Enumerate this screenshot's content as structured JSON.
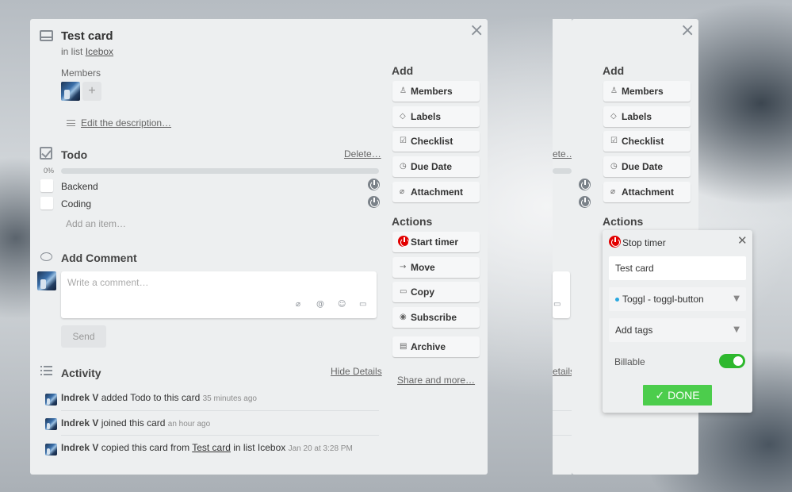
{
  "card": {
    "title": "Test card",
    "in_list_prefix": "in list",
    "list_name": "Icebox",
    "members_label": "Members",
    "add_member": "+",
    "description_link": "Edit the description…"
  },
  "checklist": {
    "title": "Todo",
    "delete": "Delete…",
    "progress_text": "0%",
    "progress_value": 0,
    "items": [
      {
        "label": "Backend"
      },
      {
        "label": "Coding"
      }
    ],
    "add_item": "Add an item…"
  },
  "comment": {
    "title": "Add Comment",
    "placeholder": "Write a comment…",
    "send": "Send",
    "icons": [
      "attachment-icon",
      "mention-icon",
      "emoji-icon",
      "card-link-icon"
    ]
  },
  "activity": {
    "title": "Activity",
    "hide_details": "Hide Details",
    "entries": [
      {
        "user": "Indrek V",
        "text": "added Todo to this card",
        "time": "35 minutes ago"
      },
      {
        "user": "Indrek V",
        "text": "joined this card",
        "time": "an hour ago"
      },
      {
        "user": "Indrek V",
        "text_before": "copied this card from",
        "link": "Test card",
        "text_after": "in list Icebox",
        "time": "Jan 20 at 3:28 PM"
      }
    ]
  },
  "sidebar": {
    "add_heading": "Add",
    "add_buttons": [
      {
        "label": "Members",
        "icon": "person-icon"
      },
      {
        "label": "Labels",
        "icon": "tag-icon"
      },
      {
        "label": "Checklist",
        "icon": "checklist-icon"
      },
      {
        "label": "Due Date",
        "icon": "clock-icon"
      },
      {
        "label": "Attachment",
        "icon": "paperclip-icon"
      }
    ],
    "actions_heading": "Actions",
    "action_buttons": [
      {
        "label": "Start timer",
        "icon": "power-icon"
      },
      {
        "label": "Move",
        "icon": "arrow-right-icon"
      },
      {
        "label": "Copy",
        "icon": "copy-icon"
      },
      {
        "label": "Subscribe",
        "icon": "eye-icon"
      },
      {
        "label": "Archive",
        "icon": "archive-icon"
      }
    ],
    "share_link": "Share and more…"
  },
  "right_card": {
    "delete_partial": "ete…",
    "details_partial": "etails"
  },
  "toggl_popup": {
    "header": "Stop timer",
    "description": "Test card",
    "project": "Toggl - toggl-button",
    "project_color": "#29a8e0",
    "tags_placeholder": "Add tags",
    "billable_label": "Billable",
    "billable": true,
    "done": "DONE",
    "done_color": "#4ccd4c"
  }
}
